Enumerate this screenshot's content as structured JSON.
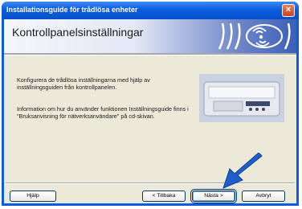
{
  "window": {
    "title": "Installationsguide för trådlösa enheter",
    "close_glyph": "×"
  },
  "banner": {
    "heading": "Kontrollpanelsinställningar",
    "icon": "wireless-waves-icon"
  },
  "content": {
    "paragraph1": "Konfigurera de trådlösa inställningarna med hjälp av inställningsguiden från kontrollpanelen.",
    "paragraph2": "Information om hur du använder funktionen Inställningsguide finns i \"Bruksanvisning för nätverksanvändare\" på cd-skivan.",
    "illustration": "printer-control-panel-icon"
  },
  "buttons": {
    "help": "Hjälp",
    "back": "< Tillbaka",
    "next": "Nästa >",
    "cancel": "Avbryt"
  },
  "colors": {
    "titlebar": "#0a5ce0",
    "dialog_bg": "#ece9d8",
    "pointer_arrow": "#1f5fc8"
  }
}
